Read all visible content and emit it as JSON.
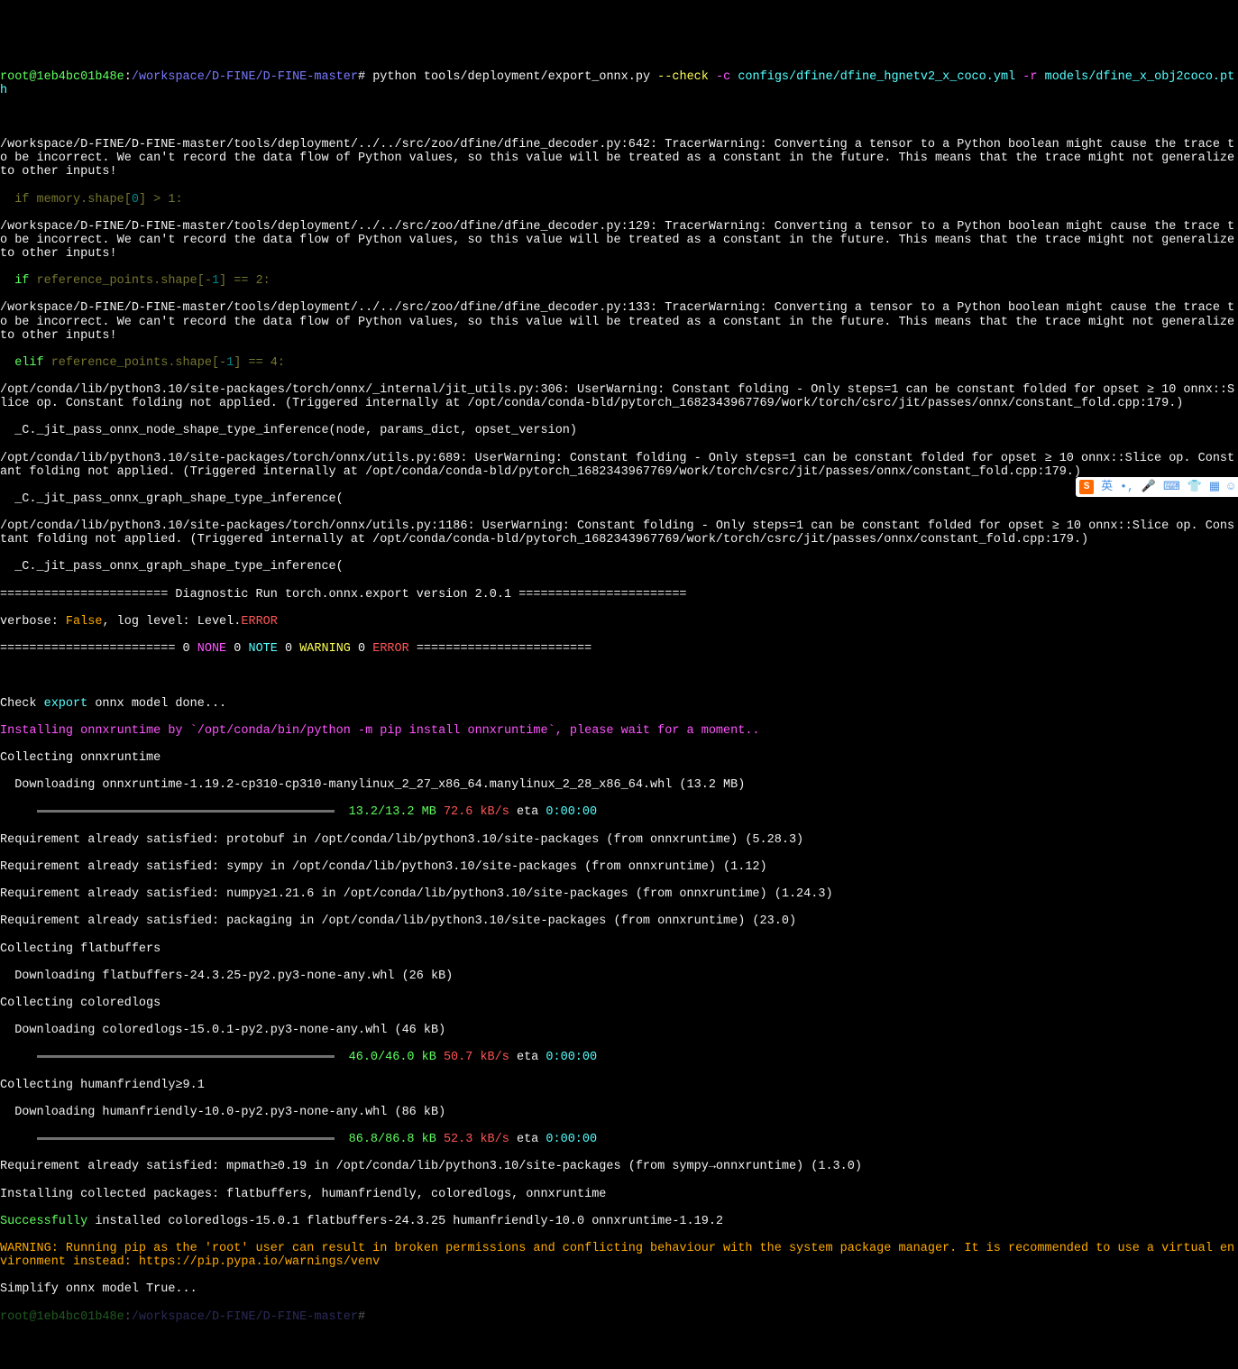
{
  "prompt": {
    "user_host": "root@1eb4bc01b48e",
    "path": "/workspace/D-FINE/D-FINE-master",
    "cmd": "python tools/deployment/export_onnx.py",
    "flag_check": "--check",
    "flag_c": "-c",
    "cfg": "configs/dfine/dfine_hgnetv2_x_coco.yml",
    "flag_r": "-r",
    "model": "models/dfine_x_obj2coco.pth"
  },
  "warn1": {
    "path": "/workspace/D-FINE/D-FINE-master/tools/deployment/../../src/zoo/dfine/dfine_decoder.py:642: TracerWarning: Converting a tensor to a Python boolean might cause the trace to be incorrect. We can't record the data flow of Python values, so this value will be treated as a constant in the future. This means that the trace might not generalize to other inputs!",
    "code_pre": "  if memory.shape[",
    "code_idx": "0",
    "code_post": "] > 1:"
  },
  "warn2": {
    "path": "/workspace/D-FINE/D-FINE-master/tools/deployment/../../src/zoo/dfine/dfine_decoder.py:129: TracerWarning: Converting a tensor to a Python boolean might cause the trace to be incorrect. We can't record the data flow of Python values, so this value will be treated as a constant in the future. This means that the trace might not generalize to other inputs!",
    "code_kw": "if",
    "code_mid": " reference_points.shape[-",
    "code_idx": "1",
    "code_post": "] == 2:"
  },
  "warn3": {
    "path": "/workspace/D-FINE/D-FINE-master/tools/deployment/../../src/zoo/dfine/dfine_decoder.py:133: TracerWarning: Converting a tensor to a Python boolean might cause the trace to be incorrect. We can't record the data flow of Python values, so this value will be treated as a constant in the future. This means that the trace might not generalize to other inputs!",
    "code_kw": "elif",
    "code_mid": " reference_points.shape[-",
    "code_idx": "1",
    "code_post": "] == 4:"
  },
  "warn4": {
    "text": "/opt/conda/lib/python3.10/site-packages/torch/onnx/_internal/jit_utils.py:306: UserWarning: Constant folding - Only steps=1 can be constant folded for opset ≥ 10 onnx::Slice op. Constant folding not applied. (Triggered internally at /opt/conda/conda-bld/pytorch_1682343967769/work/torch/csrc/jit/passes/onnx/constant_fold.cpp:179.)",
    "code": "  _C._jit_pass_onnx_node_shape_type_inference(node, params_dict, opset_version)"
  },
  "warn5": {
    "text": "/opt/conda/lib/python3.10/site-packages/torch/onnx/utils.py:689: UserWarning: Constant folding - Only steps=1 can be constant folded for opset ≥ 10 onnx::Slice op. Constant folding not applied. (Triggered internally at /opt/conda/conda-bld/pytorch_1682343967769/work/torch/csrc/jit/passes/onnx/constant_fold.cpp:179.)",
    "code": "  _C._jit_pass_onnx_graph_shape_type_inference("
  },
  "warn6": {
    "text": "/opt/conda/lib/python3.10/site-packages/torch/onnx/utils.py:1186: UserWarning: Constant folding - Only steps=1 can be constant folded for opset ≥ 10 onnx::Slice op. Constant folding not applied. (Triggered internally at /opt/conda/conda-bld/pytorch_1682343967769/work/torch/csrc/jit/passes/onnx/constant_fold.cpp:179.)",
    "code": "  _C._jit_pass_onnx_graph_shape_type_inference("
  },
  "diag": {
    "header": "======================= Diagnostic Run torch.onnx.export version 2.0.1 =======================",
    "verbose_lbl": "verbose: ",
    "verbose_val": "False",
    "loglvl": ", log level: Level.",
    "error": "ERROR",
    "bar_l": "======================== 0 ",
    "none": "NONE",
    "zero1": " 0 ",
    "note": "NOTE",
    "zero2": " 0 ",
    "warning": "WARNING",
    "zero3": " 0 ",
    "error2": "ERROR",
    "bar_r": " ========================"
  },
  "check": {
    "pre": "Check ",
    "export": "export",
    "post": " onnx model done..."
  },
  "install": {
    "msg": "Installing onnxruntime by `/opt/conda/bin/python -m pip install onnxruntime`, please wait for a moment.."
  },
  "pip": {
    "collecting_onnx": "Collecting onnxruntime",
    "dl_onnx": "  Downloading onnxruntime-1.19.2-cp310-cp310-manylinux_2_27_x86_64.manylinux_2_28_x86_64.whl (13.2 MB)",
    "onnx_size": "13.2/13.2 MB",
    "onnx_speed": "72.6 kB/s",
    "eta_lbl": " eta ",
    "onnx_eta": "0:00:00",
    "req_protobuf": "Requirement already satisfied: protobuf in /opt/conda/lib/python3.10/site-packages (from onnxruntime) (5.28.3)",
    "req_sympy": "Requirement already satisfied: sympy in /opt/conda/lib/python3.10/site-packages (from onnxruntime) (1.12)",
    "req_numpy": "Requirement already satisfied: numpy≥1.21.6 in /opt/conda/lib/python3.10/site-packages (from onnxruntime) (1.24.3)",
    "req_packaging": "Requirement already satisfied: packaging in /opt/conda/lib/python3.10/site-packages (from onnxruntime) (23.0)",
    "collecting_flat": "Collecting flatbuffers",
    "dl_flat": "  Downloading flatbuffers-24.3.25-py2.py3-none-any.whl (26 kB)",
    "collecting_color": "Collecting coloredlogs",
    "dl_color": "  Downloading coloredlogs-15.0.1-py2.py3-none-any.whl (46 kB)",
    "color_size": "46.0/46.0 kB",
    "color_speed": "50.7 kB/s",
    "color_eta": "0:00:00",
    "collecting_human": "Collecting humanfriendly≥9.1",
    "dl_human": "  Downloading humanfriendly-10.0-py2.py3-none-any.whl (86 kB)",
    "human_size": "86.8/86.8 kB",
    "human_speed": "52.3 kB/s",
    "human_eta": "0:00:00",
    "req_mpmath": "Requirement already satisfied: mpmath≥0.19 in /opt/conda/lib/python3.10/site-packages (from sympy→onnxruntime) (1.3.0)",
    "installing": "Installing collected packages: flatbuffers, humanfriendly, coloredlogs, onnxruntime",
    "success_lbl": "Successfully",
    "success_rest": " installed coloredlogs-15.0.1 flatbuffers-24.3.25 humanfriendly-10.0 onnxruntime-1.19.2",
    "warning_root": "WARNING: Running pip as the 'root' user can result in broken permissions and conflicting behaviour with the system package manager. It is recommended to use a virtual environment instead: https://pip.pypa.io/warnings/venv"
  },
  "simplify": "Simplify onnx model True...",
  "prompt2": {
    "user_host": "root@1eb4bc01b48e",
    "path": "/workspace/D-FINE/D-FINE-master"
  },
  "ime": {
    "logo": "S",
    "lang": "英"
  }
}
